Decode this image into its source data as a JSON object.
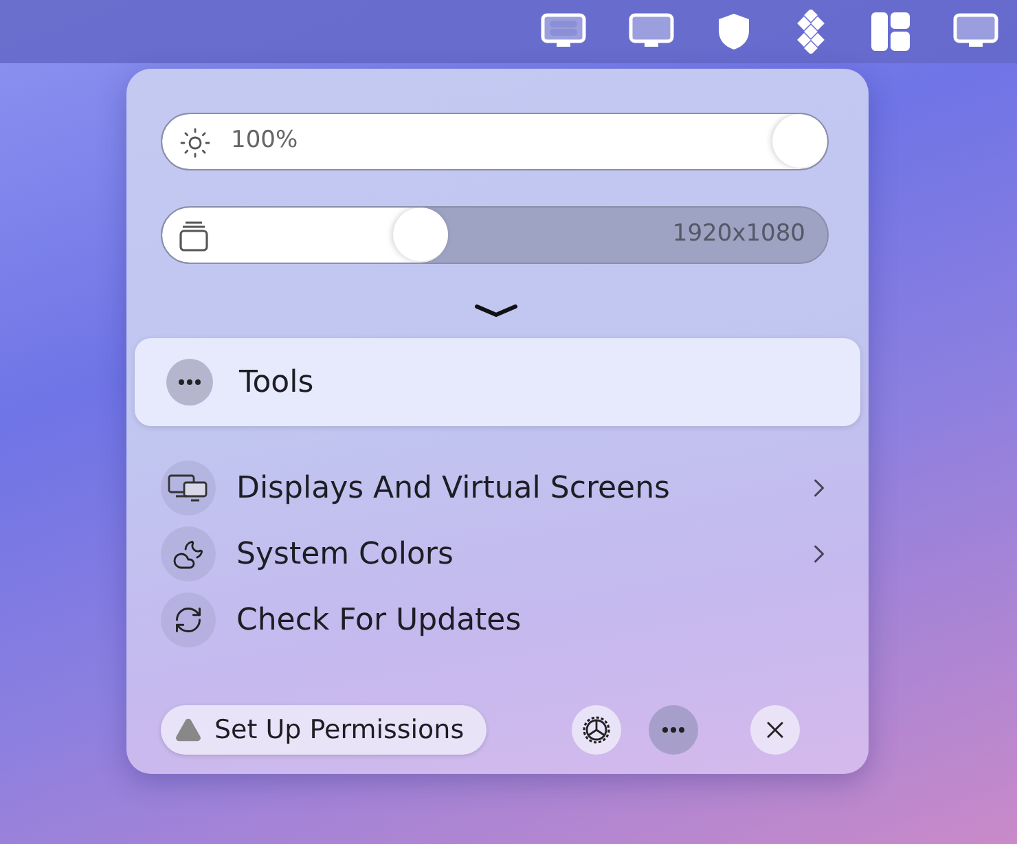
{
  "sliders": [
    {
      "kind": "brightness",
      "label": "100%",
      "level": 1
    },
    {
      "kind": "resolution",
      "label": "1920x1080",
      "level": 0.43
    }
  ],
  "tools_row": {
    "label": "Tools",
    "selected": true
  },
  "menu_items": [
    {
      "kind": "displays",
      "label": "Displays And Virtual Screens",
      "submenu": true
    },
    {
      "kind": "colors",
      "label": "System Colors",
      "submenu": true
    },
    {
      "kind": "updates",
      "label": "Check For Updates",
      "submenu": false
    }
  ],
  "footer": {
    "permissions_label": "Set Up Permissions",
    "buttons": [
      {
        "kind": "settings",
        "selected": false
      },
      {
        "kind": "more",
        "selected": true
      },
      {
        "kind": "close",
        "selected": false
      }
    ]
  }
}
